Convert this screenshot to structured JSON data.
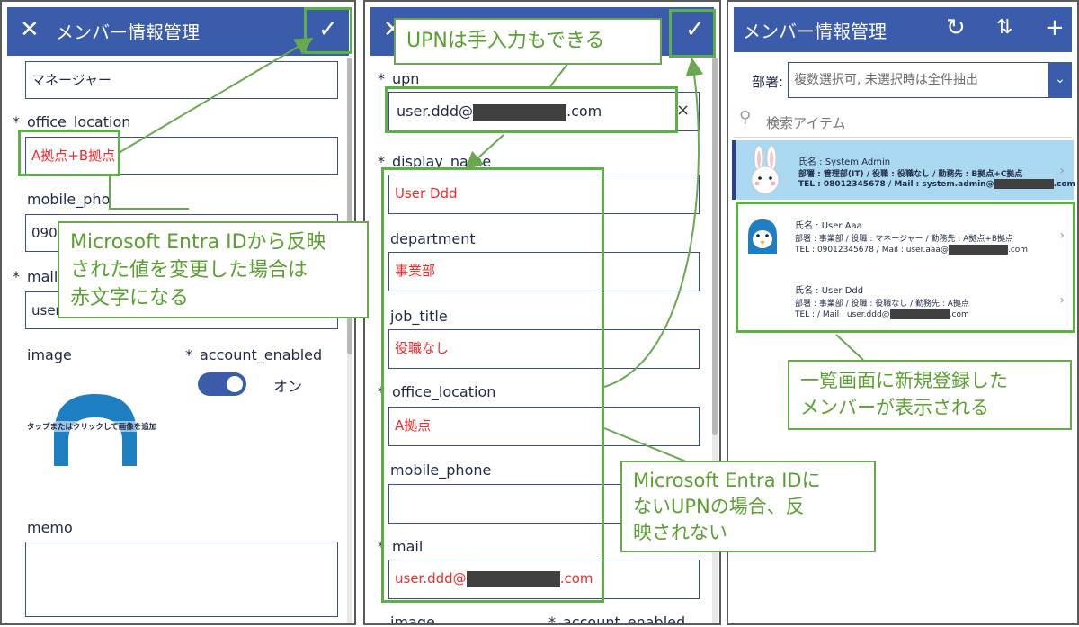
{
  "panel1": {
    "title": "メンバー情報管理",
    "job_title_value": "マネージャー",
    "office_location_label": "office_location",
    "office_location_value": "A拠点+B拠点",
    "mobile_phone_label": "mobile_pho",
    "mobile_phone_value": "0901",
    "mail_label": "mail",
    "mail_value": "user",
    "image_label": "image",
    "account_enabled_label": "account_enabled",
    "toggle_text": "オン",
    "image_hint": "タップまたはクリックして画像を追加",
    "memo_label": "memo"
  },
  "panel2": {
    "upn_label": "upn",
    "upn_prefix": "user.ddd@",
    "upn_suffix": ".com",
    "clear_symbol": "×",
    "display_name_label": "display_name",
    "display_name_value": "User Ddd",
    "department_label": "department",
    "department_value": "事業部",
    "job_title_label": "job_title",
    "job_title_value": "役職なし",
    "office_location_label": "office_location",
    "office_location_value": "A拠点",
    "mobile_phone_label": "mobile_phone",
    "mobile_phone_value": "",
    "mail_label": "mail",
    "mail_prefix": "user.ddd@",
    "mail_suffix": ".com",
    "bottom_left_label": "image",
    "bottom_right_label": "account_enabled"
  },
  "panel3": {
    "title": "メンバー情報管理",
    "dept_label": "部署:",
    "dept_placeholder": "複数選択可, 未選択時は全件抽出",
    "search_placeholder": "検索アイテム",
    "items": [
      {
        "name": "氏名 : System Admin",
        "line1": "部署 : 管理部(IT) / 役職 : 役職なし / 勤務先 : B拠点+C拠点",
        "line2_prefix": "TEL : 08012345678 / Mail : system.admin@",
        "line2_suffix": ".com"
      },
      {
        "name": "氏名 : User Aaa",
        "line1": "部署 : 事業部 / 役職 : マネージャー / 勤務先 : A拠点+B拠点",
        "line2_prefix": "TEL : 09012345678 / Mail : user.aaa@",
        "line2_suffix": ".com"
      },
      {
        "name": "氏名 : User Ddd",
        "line1": "部署 : 事業部 / 役職 : 役職なし / 勤務先 : A拠点",
        "line2_prefix": "TEL : / Mail : user.ddd@",
        "line2_suffix": ".com"
      }
    ]
  },
  "callouts": {
    "entra_reflect": [
      "Microsoft Entra IDから反映",
      "された値を変更した場合は",
      "赤文字になる"
    ],
    "upn_manual": "UPNは手入力もできる",
    "not_reflected": [
      "Microsoft Entra IDに",
      "ないUPNの場合、反",
      "映されない"
    ],
    "new_member": [
      "一覧画面に新規登録した",
      "メンバーが表示される"
    ]
  },
  "colors": {
    "header": "#3b5bab",
    "field_border": "#3c4d8f",
    "red_text": "#ef2b2b",
    "callout_green": "#6aa84f",
    "selected_row": "#a9d8f0"
  }
}
